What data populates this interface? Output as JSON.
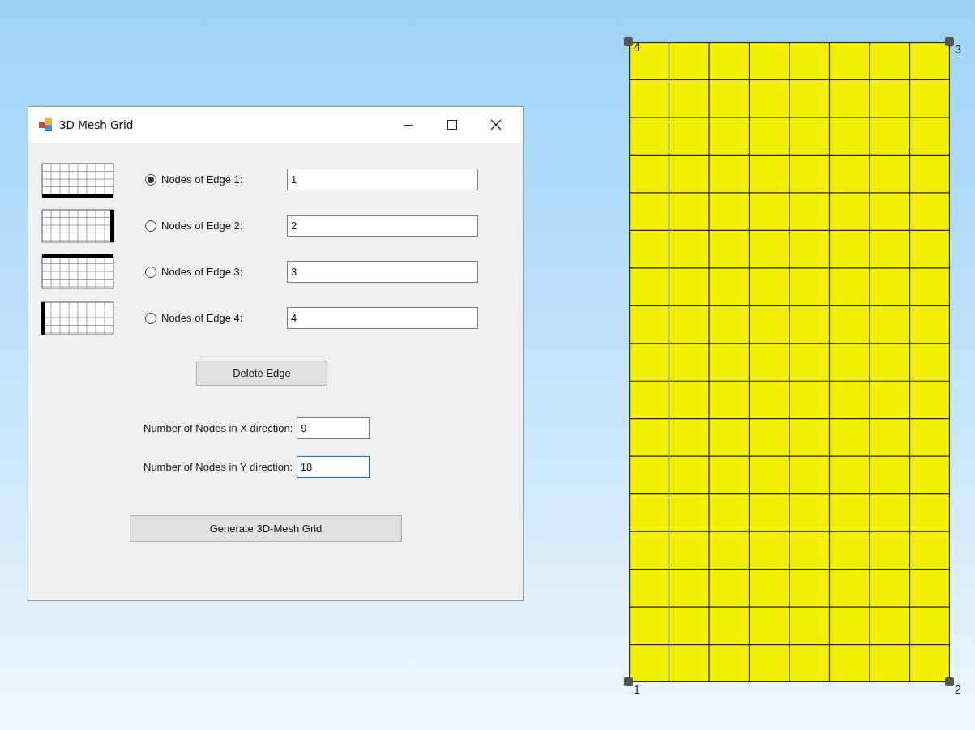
{
  "window": {
    "title": "3D Mesh Grid"
  },
  "edges": [
    {
      "label": "Nodes of Edge 1:",
      "value": "1",
      "selected": true
    },
    {
      "label": "Nodes of Edge 2:",
      "value": "2",
      "selected": false
    },
    {
      "label": "Nodes of Edge 3:",
      "value": "3",
      "selected": false
    },
    {
      "label": "Nodes of Edge 4:",
      "value": "4",
      "selected": false
    }
  ],
  "delete_button": "Delete Edge",
  "nodes_x": {
    "label": "Number of Nodes in X direction:",
    "value": "9",
    "focused": false
  },
  "nodes_y": {
    "label": "Number of Nodes in Y direction:",
    "value": "18",
    "focused": true
  },
  "generate_button": "Generate 3D-Mesh Grid",
  "mesh": {
    "corners": [
      {
        "label": "4"
      },
      {
        "label": "3"
      },
      {
        "label": "1"
      },
      {
        "label": "2"
      }
    ]
  }
}
